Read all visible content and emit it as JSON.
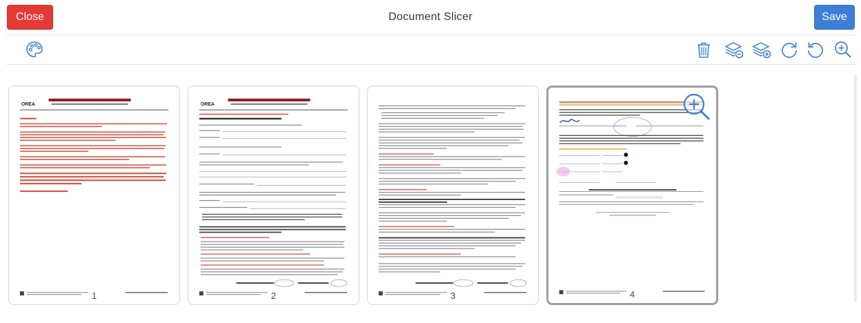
{
  "header": {
    "close_label": "Close",
    "title": "Document Slicer",
    "save_label": "Save"
  },
  "colors": {
    "close": "#e53935",
    "save": "#3d7fd6",
    "icon": "#3d7fd6"
  },
  "toolbar": {
    "left_tools": [
      {
        "icon": "palette-icon"
      }
    ],
    "right_tools": [
      {
        "icon": "trash-icon"
      },
      {
        "icon": "layers-remove-icon"
      },
      {
        "icon": "layers-add-icon"
      },
      {
        "icon": "rotate-clockwise-icon"
      },
      {
        "icon": "rotate-counterclockwise-icon"
      },
      {
        "icon": "zoom-in-icon"
      }
    ]
  },
  "pages": [
    {
      "number": "1",
      "selected": false
    },
    {
      "number": "2",
      "selected": false
    },
    {
      "number": "3",
      "selected": false
    },
    {
      "number": "4",
      "selected": true
    }
  ]
}
